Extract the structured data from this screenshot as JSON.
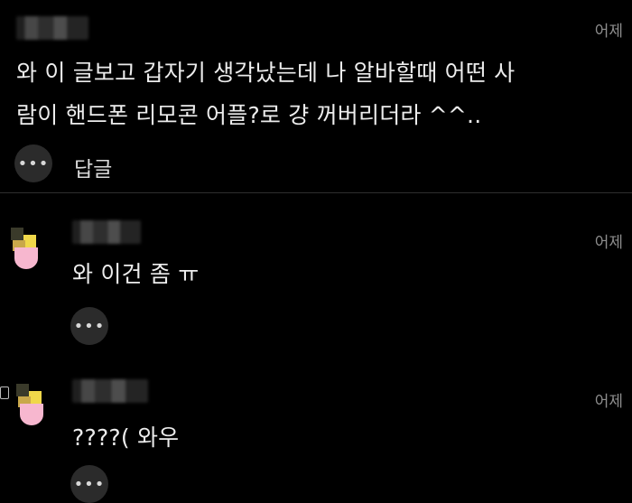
{
  "comments": [
    {
      "author_masked": true,
      "time": "어제",
      "body_line1": "와 이 글보고 갑자기 생각났는데 나 알바할때 어떤 사",
      "body_line2": "람이 핸드폰 리모콘 어플?로 걍 꺼버리더라 ^^..",
      "more": "•••",
      "reply": "답글"
    },
    {
      "author_masked": true,
      "time": "어제",
      "body": "와 이건 좀 ㅠ",
      "more": "•••",
      "is_reply": true
    },
    {
      "author_masked": true,
      "time": "어제",
      "body": "????( 와우",
      "more": "•••",
      "is_reply": true
    }
  ]
}
